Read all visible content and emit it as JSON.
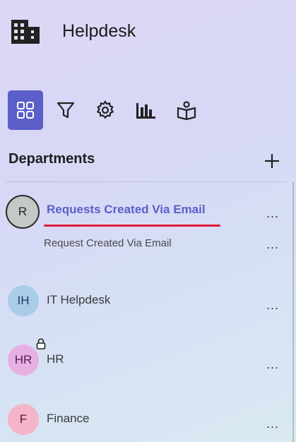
{
  "app": {
    "title": "Helpdesk",
    "logo_icon": "building-icon"
  },
  "toolbar": {
    "active_color": "#5b5fc7",
    "items": [
      {
        "name": "tickets",
        "icon": "grid-icon",
        "active": true
      },
      {
        "name": "filters",
        "icon": "filter-icon",
        "active": false
      },
      {
        "name": "settings",
        "icon": "gear-icon",
        "active": false
      },
      {
        "name": "analytics",
        "icon": "bar-chart-icon",
        "active": false
      },
      {
        "name": "knowledge-base",
        "icon": "book-icon",
        "active": false
      }
    ]
  },
  "departments": {
    "heading": "Departments",
    "add_icon": "plus-icon",
    "items": [
      {
        "initials": "R",
        "name": "Requests Created Via Email",
        "active": true,
        "children": [
          {
            "name": "Request Created Via Email"
          }
        ]
      },
      {
        "initials": "IH",
        "name": "IT Helpdesk",
        "active": false
      },
      {
        "initials": "HR",
        "name": "HR",
        "locked": true,
        "active": false
      },
      {
        "initials": "F",
        "name": "Finance",
        "active": false
      }
    ],
    "more_label": "..."
  },
  "colors": {
    "accent": "#5b5fc7",
    "underline": "#e21b3c"
  }
}
